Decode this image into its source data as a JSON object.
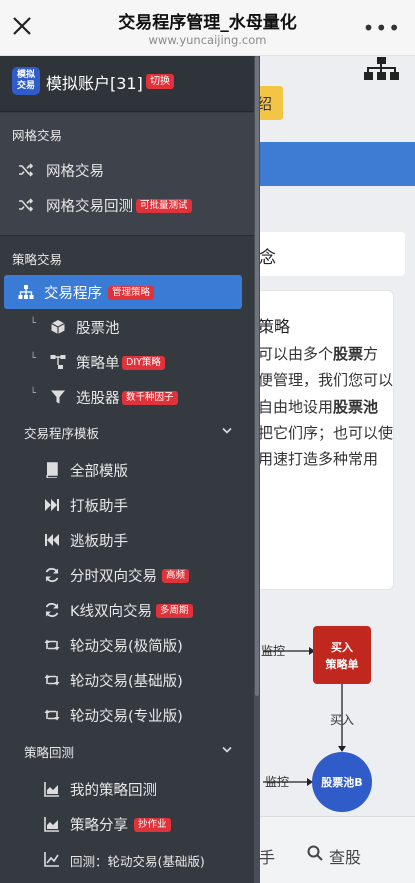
{
  "topbar": {
    "title": "交易程序管理_水母量化",
    "url": "www.yuncaijing.com"
  },
  "account": {
    "logo_line1": "模拟",
    "logo_line2": "交易",
    "name": "模拟账户[31]",
    "switch_badge": "切换"
  },
  "grid_section": {
    "label": "网格交易",
    "items": [
      {
        "label": "网格交易"
      },
      {
        "label": "网格交易回测",
        "badge": "可批量测试"
      }
    ]
  },
  "strategy_section": {
    "label": "策略交易",
    "main": {
      "label": "交易程序",
      "badge": "管理策略"
    },
    "children": [
      {
        "label": "股票池"
      },
      {
        "label": "策略单",
        "badge": "DIY策略"
      },
      {
        "label": "选股器",
        "badge": "数千种因子"
      }
    ]
  },
  "template_section": {
    "label": "交易程序模板",
    "items": [
      {
        "label": "全部模版"
      },
      {
        "label": "打板助手"
      },
      {
        "label": "逃板助手"
      },
      {
        "label": "分时双向交易",
        "badge": "高频"
      },
      {
        "label": "K线双向交易",
        "badge": "多周期"
      },
      {
        "label": "轮动交易(极简版)"
      },
      {
        "label": "轮动交易(基础版)"
      },
      {
        "label": "轮动交易(专业版)"
      }
    ]
  },
  "backtest_section": {
    "label": "策略回测",
    "items": [
      {
        "label": "我的策略回测"
      },
      {
        "label": "策略分享",
        "badge": "抄作业"
      },
      {
        "label": "回测：轮动交易(基础版)"
      }
    ]
  },
  "background": {
    "yellow_tab": "绍",
    "card_title": "念",
    "card_heading": "策略",
    "card_text_parts": [
      "可以由多个",
      "股票",
      "方便管理，我们您可以自由地设用",
      "股票池",
      "把它们序；也可以使用速打造多种常用"
    ],
    "diagram": {
      "buy_line1": "买入",
      "buy_line2": "策略单",
      "monitor_top": "监控",
      "buy_arrow": "买入",
      "monitor_bottom": "监控",
      "pool": "股票池B"
    },
    "bottom_left": "手",
    "bottom_right": "查股"
  },
  "colors": {
    "sidebar_bg": "#353a41",
    "active": "#3a7bd5",
    "badge": "#e0323a",
    "diagram_red": "#c0271f",
    "diagram_blue": "#2f5cc8"
  }
}
